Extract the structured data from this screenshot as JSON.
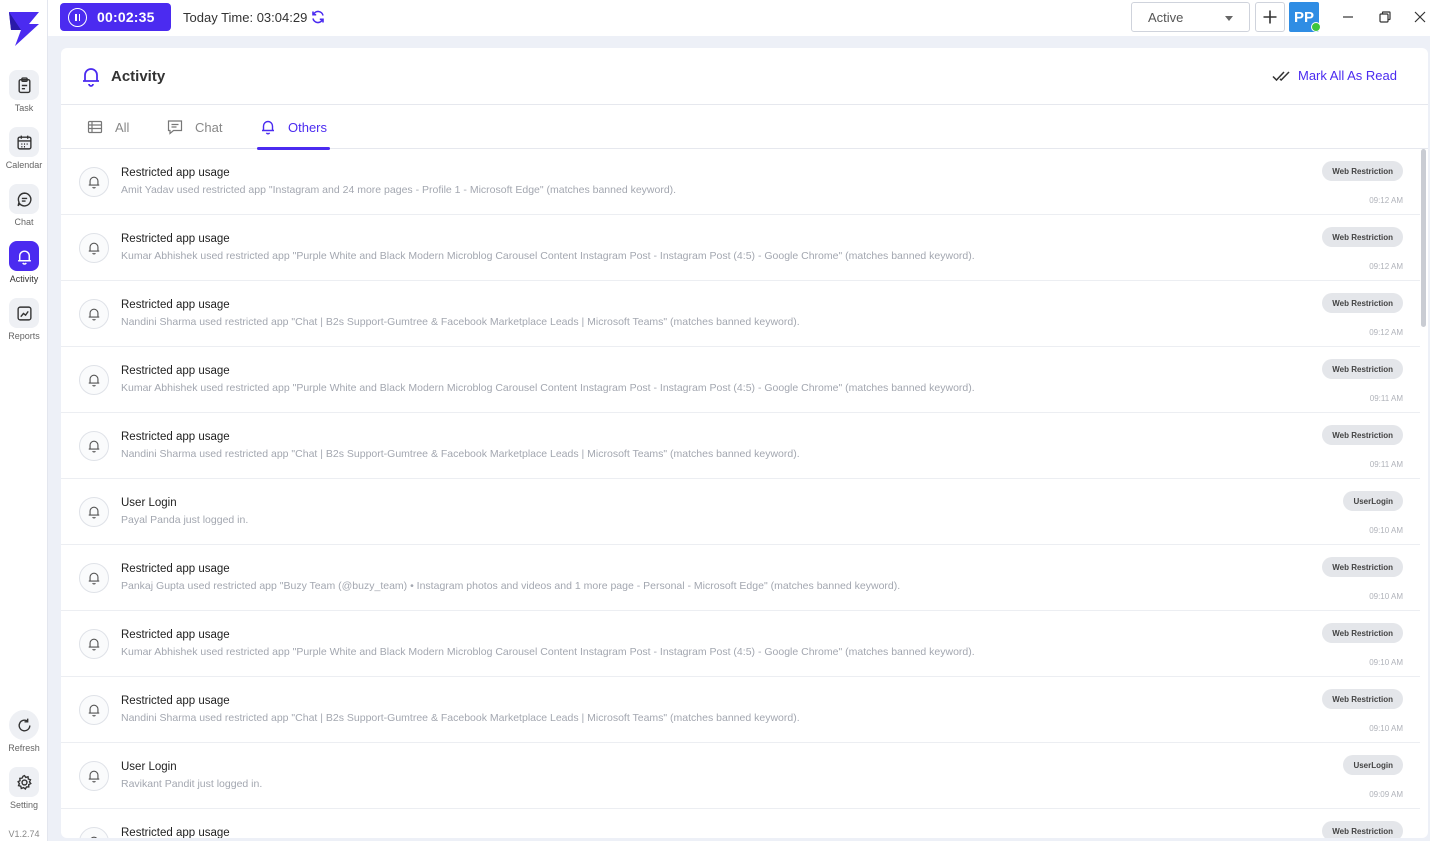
{
  "sidebar": {
    "items": [
      {
        "label": "Task",
        "icon": "clipboard-icon"
      },
      {
        "label": "Calendar",
        "icon": "calendar-icon"
      },
      {
        "label": "Chat",
        "icon": "chat-bubble-icon"
      },
      {
        "label": "Activity",
        "icon": "bell-icon"
      },
      {
        "label": "Reports",
        "icon": "chart-icon"
      }
    ],
    "refresh_label": "Refresh",
    "setting_label": "Setting",
    "version": "V1.2.74"
  },
  "topbar": {
    "timer": "00:02:35",
    "today_time": "Today Time: 03:04:29",
    "status": "Active",
    "avatar_initials": "PP"
  },
  "colors": {
    "accent": "#4b2bf0",
    "avatar": "#2f8de4",
    "online": "#3ec63e"
  },
  "panel": {
    "title": "Activity",
    "mark_all_read": "Mark All As Read",
    "tabs": [
      {
        "label": "All",
        "icon": "table-icon"
      },
      {
        "label": "Chat",
        "icon": "message-icon"
      },
      {
        "label": "Others",
        "icon": "bell-icon",
        "active": true
      }
    ]
  },
  "notifications": [
    {
      "title": "Restricted app usage",
      "desc": "Amit Yadav used restricted app \"Instagram and 24 more pages - Profile 1 - Microsoft Edge\" (matches banned keyword).",
      "badge": "Web Restriction",
      "time": "09:12 AM"
    },
    {
      "title": "Restricted app usage",
      "desc": "Kumar Abhishek used restricted app \"Purple White and Black Modern Microblog Carousel Content Instagram Post - Instagram Post (4:5) - Google Chrome\" (matches banned keyword).",
      "badge": "Web Restriction",
      "time": "09:12 AM"
    },
    {
      "title": "Restricted app usage",
      "desc": "Nandini Sharma used restricted app \"Chat | B2s Support-Gumtree & Facebook Marketplace Leads | Microsoft Teams\" (matches banned keyword).",
      "badge": "Web Restriction",
      "time": "09:12 AM"
    },
    {
      "title": "Restricted app usage",
      "desc": "Kumar Abhishek used restricted app \"Purple White and Black Modern Microblog Carousel Content Instagram Post - Instagram Post (4:5) - Google Chrome\" (matches banned keyword).",
      "badge": "Web Restriction",
      "time": "09:11 AM"
    },
    {
      "title": "Restricted app usage",
      "desc": "Nandini Sharma used restricted app \"Chat | B2s Support-Gumtree & Facebook Marketplace Leads | Microsoft Teams\" (matches banned keyword).",
      "badge": "Web Restriction",
      "time": "09:11 AM"
    },
    {
      "title": "User Login",
      "desc": "Payal Panda just logged in.",
      "badge": "UserLogin",
      "time": "09:10 AM"
    },
    {
      "title": "Restricted app usage",
      "desc": "Pankaj Gupta used restricted app \"Buzy Team (@buzy_team) • Instagram photos and videos and 1 more page - Personal - Microsoft Edge\" (matches banned keyword).",
      "badge": "Web Restriction",
      "time": "09:10 AM"
    },
    {
      "title": "Restricted app usage",
      "desc": "Kumar Abhishek used restricted app \"Purple White and Black Modern Microblog Carousel Content Instagram Post - Instagram Post (4:5) - Google Chrome\" (matches banned keyword).",
      "badge": "Web Restriction",
      "time": "09:10 AM"
    },
    {
      "title": "Restricted app usage",
      "desc": "Nandini Sharma used restricted app \"Chat | B2s Support-Gumtree & Facebook Marketplace Leads | Microsoft Teams\" (matches banned keyword).",
      "badge": "Web Restriction",
      "time": "09:10 AM"
    },
    {
      "title": "User Login",
      "desc": "Ravikant Pandit just logged in.",
      "badge": "UserLogin",
      "time": "09:09 AM"
    },
    {
      "title": "Restricted app usage",
      "desc": "",
      "badge": "Web Restriction",
      "time": ""
    }
  ]
}
